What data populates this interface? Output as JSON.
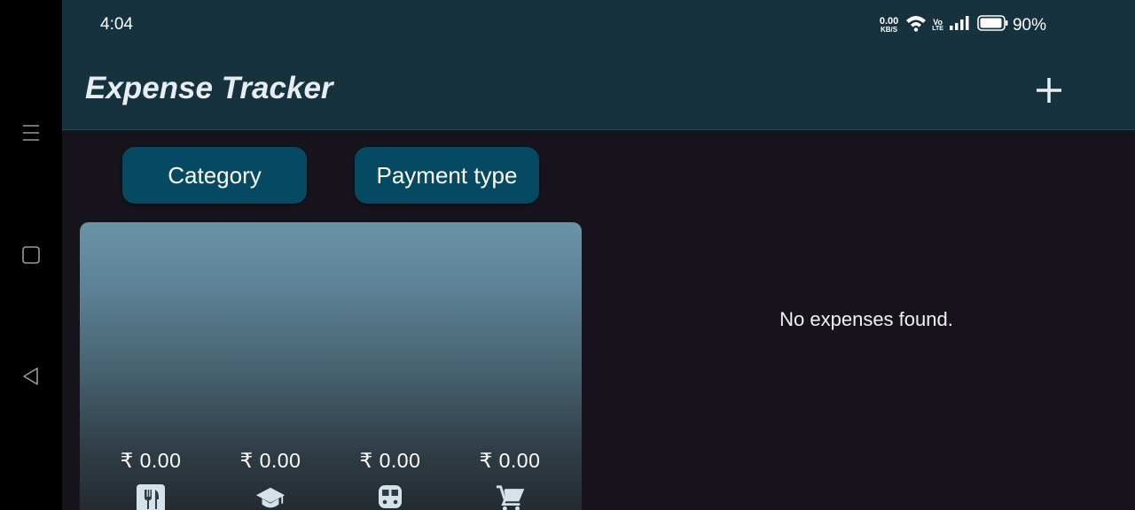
{
  "status_bar": {
    "time": "4:04",
    "net_speed": "0.00",
    "net_unit": "KB/S",
    "volte_top": "Vo",
    "volte_bottom": "LTE",
    "battery": "90%",
    "icons": [
      "wifi-icon",
      "volte-icon",
      "signal-icon",
      "battery-icon"
    ]
  },
  "system_nav": {
    "icons": [
      "menu-icon",
      "home-square-icon",
      "back-triangle-icon"
    ]
  },
  "app_bar": {
    "title": "Expense Tracker",
    "add_icon": "plus-icon"
  },
  "filters": {
    "category_label": "Category",
    "payment_label": "Payment type"
  },
  "summary": {
    "items": [
      {
        "amount": "₹ 0.00",
        "icon": "restaurant-icon"
      },
      {
        "amount": "₹ 0.00",
        "icon": "school-icon"
      },
      {
        "amount": "₹ 0.00",
        "icon": "train-icon"
      },
      {
        "amount": "₹ 0.00",
        "icon": "shopping-cart-icon"
      }
    ]
  },
  "expenses": {
    "empty_message": "No expenses found."
  },
  "colors": {
    "app_bar": "#16323f",
    "background": "#17141c",
    "chip": "#054a62",
    "card_top": "#6a93a8",
    "card_bottom": "#22272c"
  }
}
